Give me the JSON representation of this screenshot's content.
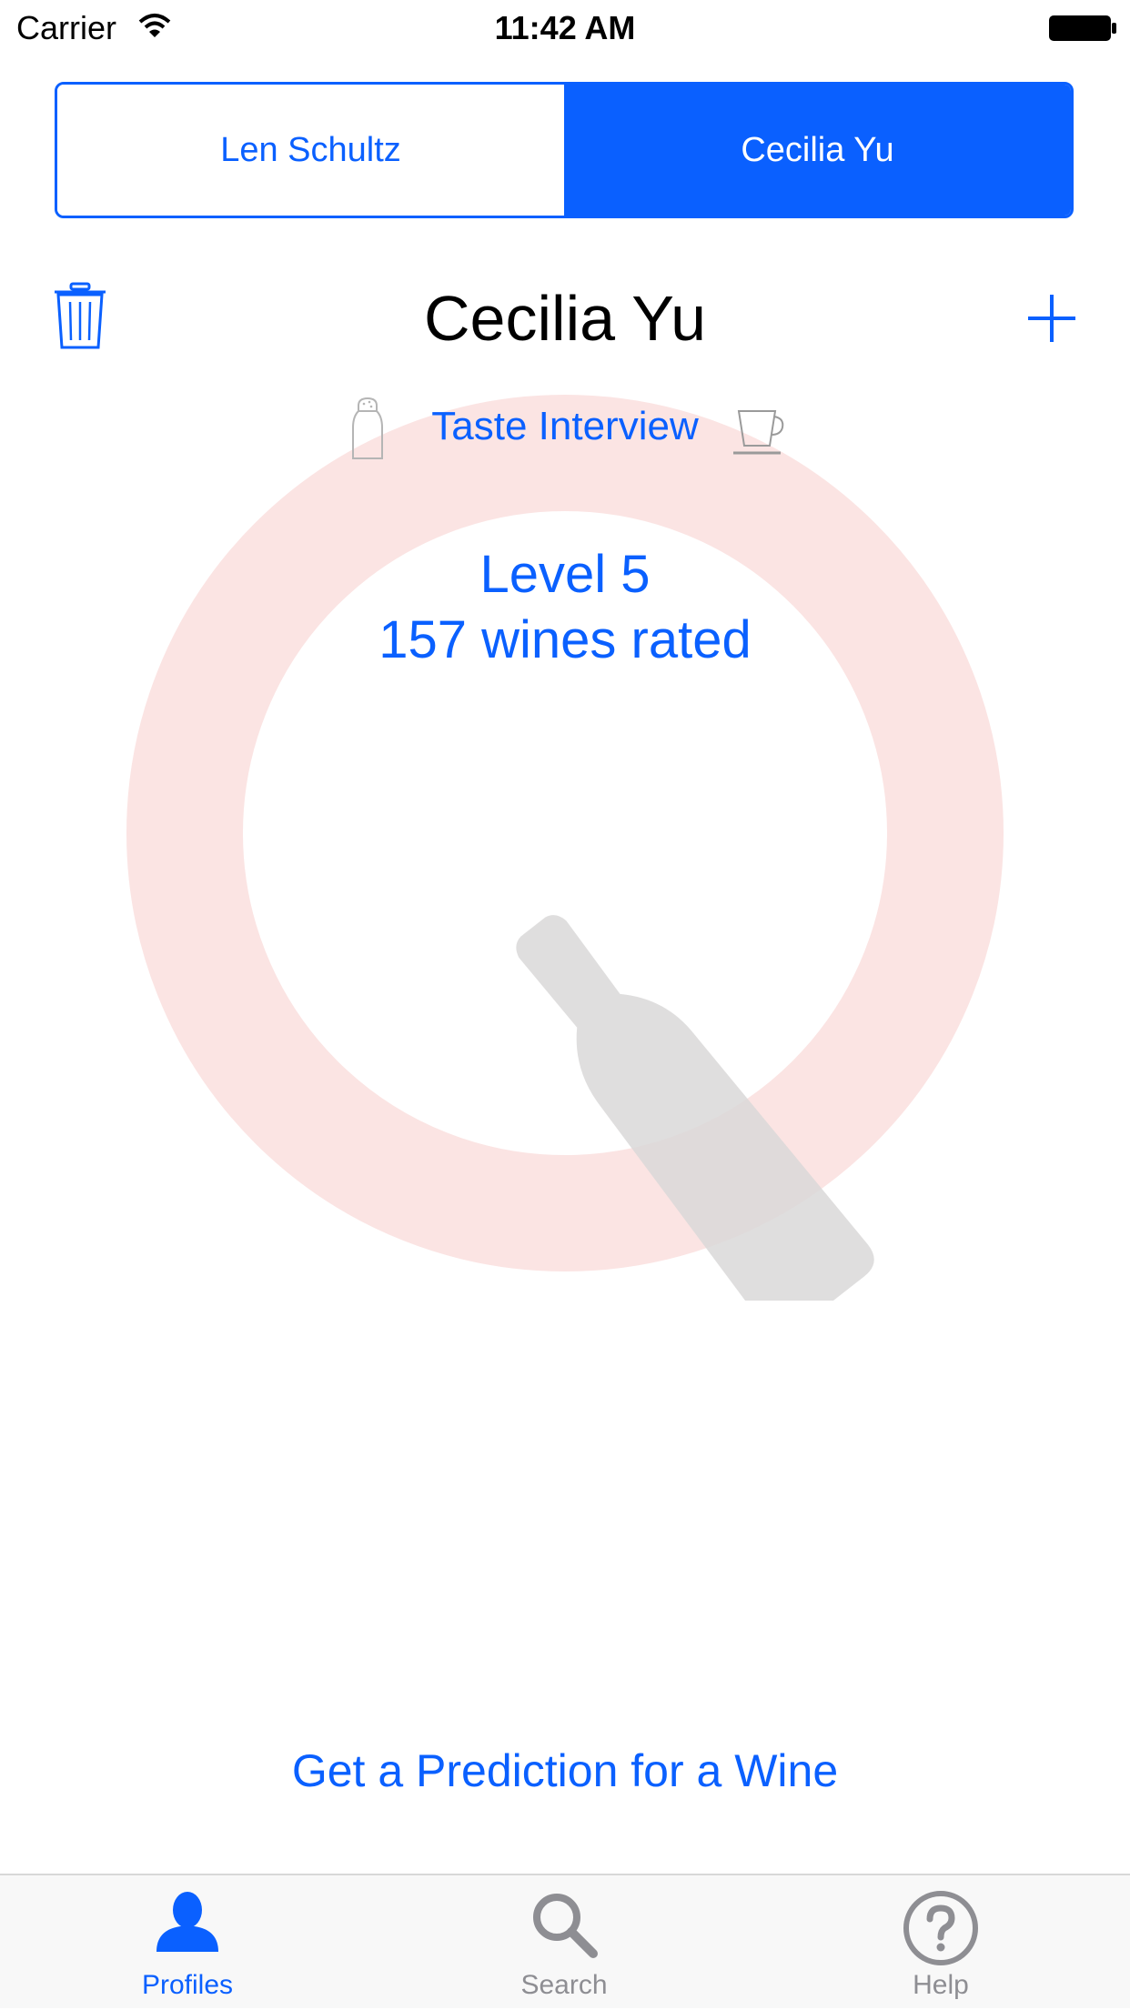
{
  "status_bar": {
    "carrier": "Carrier",
    "time": "11:42 AM"
  },
  "segmented_control": {
    "segments": [
      {
        "label": "Len Schultz",
        "selected": false
      },
      {
        "label": "Cecilia Yu",
        "selected": true
      }
    ]
  },
  "profile": {
    "name": "Cecilia Yu",
    "level": "Level 5",
    "wines_rated": "157 wines rated"
  },
  "taste_interview": {
    "label": "Taste Interview"
  },
  "prediction": {
    "label": "Get a Prediction for a Wine"
  },
  "tab_bar": {
    "tabs": [
      {
        "label": "Profiles",
        "icon": "person-icon",
        "active": true
      },
      {
        "label": "Search",
        "icon": "search-icon",
        "active": false
      },
      {
        "label": "Help",
        "icon": "help-icon",
        "active": false
      }
    ]
  },
  "colors": {
    "accent": "#0a60ff",
    "ring": "#fbe4e3",
    "bottle": "#e0dfdf",
    "inactive": "#8e8e93"
  }
}
